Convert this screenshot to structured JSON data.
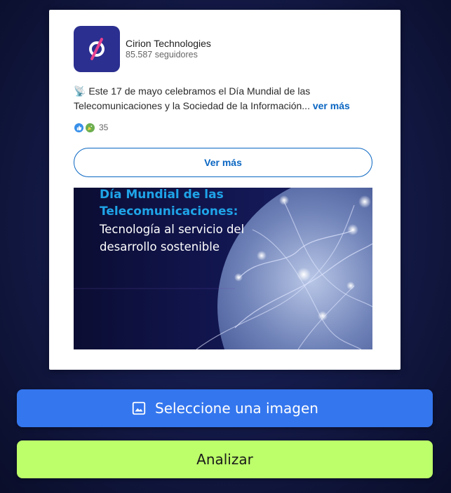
{
  "post": {
    "company_name": "Cirion Technologies",
    "followers": "85.587 seguidores",
    "text_icon": "📡",
    "text": " Este 17 de mayo celebramos el Día Mundial de las Telecomunicaciones y la Sociedad de la Información... ",
    "see_more": "ver más",
    "reaction_count": "35",
    "ver_mas_button": "Ver más",
    "image": {
      "title_line1": "Día Mundial de las",
      "title_line2": "Telecomunicaciones:",
      "subtitle": "Tecnología al servicio del desarrollo sostenible"
    }
  },
  "actions": {
    "select_image_label": "Seleccione una imagen",
    "select_image_icon": "image-icon",
    "analyze_label": "Analizar"
  },
  "colors": {
    "select_button": "#3476ee",
    "analyze_button": "#bcff6a",
    "linkedin_blue": "#0a66c2",
    "logo_bg": "#2b2f8f",
    "image_title": "#1fa4e8"
  }
}
